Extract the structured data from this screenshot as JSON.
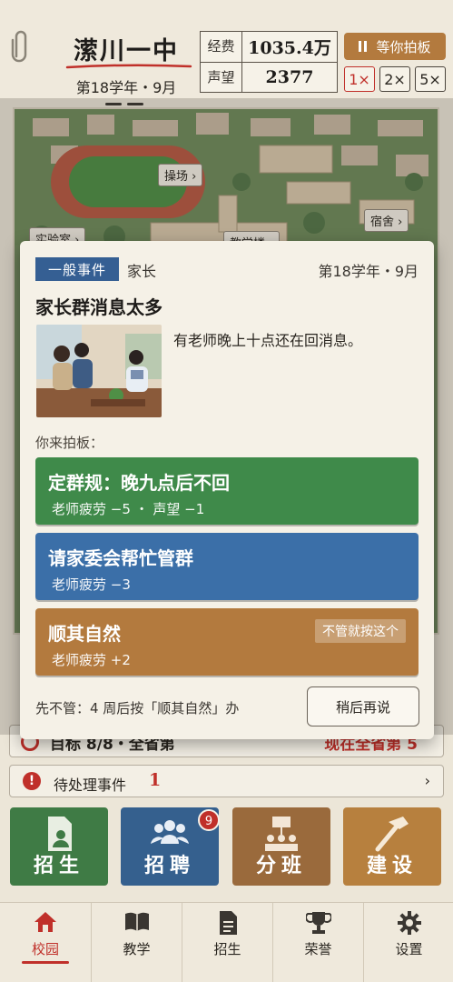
{
  "header": {
    "school_name": "潆川一中",
    "term": "第18学年・9月",
    "stats": [
      {
        "label": "经费",
        "value": "1035.4万"
      },
      {
        "label": "声望",
        "value": "2377"
      }
    ],
    "wait_button": "等你拍板",
    "speeds": [
      "1×",
      "2×",
      "5×"
    ],
    "active_speed": "1×"
  },
  "campus": {
    "labels": [
      "操场",
      "实验室",
      "宿舍",
      "教学楼"
    ]
  },
  "event": {
    "type_badge": "一般事件",
    "category": "家长",
    "date": "第18学年・9月",
    "title": "家长群消息太多",
    "description": "有老师晚上十点还在回消息。",
    "prompt": "你来拍板：",
    "choices": [
      {
        "title": "定群规：晚九点后不回",
        "effect": "老师疲劳 −5 ・ 声望 −1"
      },
      {
        "title": "请家委会帮忙管群",
        "effect": "老师疲劳 −3"
      },
      {
        "title": "顺其自然",
        "effect": "老师疲劳 +2",
        "default_tag": "不管就按这个"
      }
    ],
    "footnote": "先不管：4 周后按「顺其自然」办",
    "later_button": "稍后再说"
  },
  "goal": {
    "text": "目标 8/8・全省第",
    "right": "现在全省第 5"
  },
  "pending": {
    "label": "待处理事件",
    "count": "1"
  },
  "actions": [
    {
      "label": "招生",
      "icon": "enroll-icon"
    },
    {
      "label": "招聘",
      "icon": "recruit-icon",
      "badge": "9"
    },
    {
      "label": "分班",
      "icon": "class-assign-icon"
    },
    {
      "label": "建设",
      "icon": "hammer-icon"
    }
  ],
  "nav": [
    {
      "label": "校园",
      "icon": "home-icon",
      "active": true
    },
    {
      "label": "教学",
      "icon": "book-icon"
    },
    {
      "label": "招生",
      "icon": "document-icon"
    },
    {
      "label": "荣誉",
      "icon": "trophy-icon"
    },
    {
      "label": "设置",
      "icon": "gear-icon"
    }
  ],
  "colors": {
    "accent_red": "#c0302a",
    "badge_blue": "#355f93",
    "choice_green": "#3f8a4a",
    "choice_blue": "#3b6fa8",
    "choice_orange": "#b37a3e"
  }
}
